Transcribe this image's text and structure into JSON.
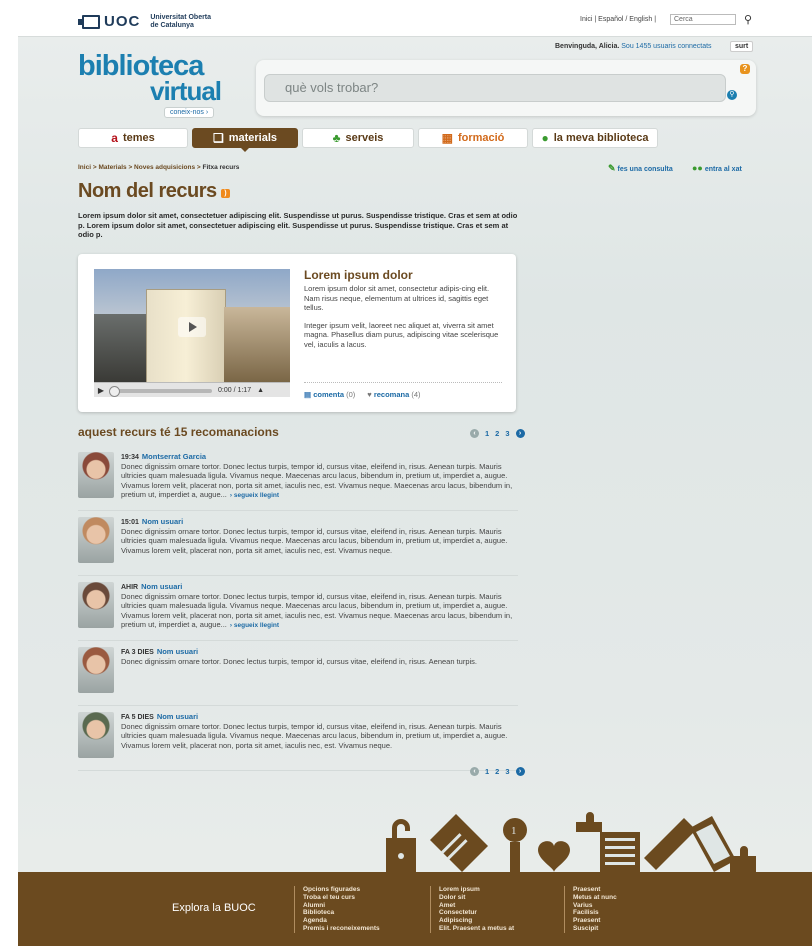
{
  "header": {
    "brand_short": "UOC",
    "brand_line1": "Universitat Oberta",
    "brand_line2": "de Catalunya",
    "toplinks": "Inici | Español / English |",
    "search_placeholder": "Cerca"
  },
  "user": {
    "welcome": "Benvinguda, Alicia.",
    "connected": "Sou 1455 usuaris connectats",
    "logout": "surt"
  },
  "logo": {
    "line1": "biblioteca",
    "line2": "virtual",
    "coneix": "coneix-nos"
  },
  "search": {
    "placeholder": "què vols trobar?"
  },
  "tabs": [
    {
      "label": "temes",
      "icon": "az-icon"
    },
    {
      "label": "materials",
      "icon": "book-icon",
      "active": true
    },
    {
      "label": "serveis",
      "icon": "services-icon"
    },
    {
      "label": "formació",
      "icon": "training-icon"
    },
    {
      "label": "la meva biblioteca",
      "icon": "person-icon"
    }
  ],
  "breadcrumb": {
    "items": [
      "Inici",
      "Materials",
      "Noves adquisicions"
    ],
    "sep": ">",
    "current": "Fitxa recurs"
  },
  "actions": {
    "consult": "fes una consulta",
    "chat": "entra al xat"
  },
  "page": {
    "title": "Nom del recurs",
    "intro": "Lorem ipsum dolor sit amet, consectetuer adipiscing elit. Suspendisse ut purus. Suspendisse tristique. Cras et sem at odio p. Lorem ipsum dolor sit amet, consectetuer adipiscing elit. Suspendisse ut purus. Suspendisse tristique. Cras et sem at odio p."
  },
  "card": {
    "title": "Lorem ipsum dolor",
    "para1": "Lorem ipsum dolor sit amet, consectetur adipis-cing elit. Nam risus neque, elementum at ultrices id, sagittis eget tellus.",
    "para2": "Integer ipsum velit, laoreet nec aliquet at, viverra sit amet magna. Phasellus diam purus, adipiscing vitae scelerisque vel, iaculis a lacus.",
    "time": "0:00 / 1:17",
    "progress": 0,
    "comment_label": "comenta",
    "comment_count": "(0)",
    "recommend_label": "recomana",
    "recommend_count": "(4)"
  },
  "recs": {
    "title": "aquest recurs té 15 recomanacions",
    "pages": [
      "1",
      "2",
      "3"
    ],
    "more": "segueix llegint",
    "items": [
      {
        "time": "19:34",
        "name": "Montserrat Garcia",
        "text": "Donec dignissim ornare tortor. Donec lectus turpis, tempor id, cursus vitae, eleifend in, risus. Aenean turpis. Mauris ultricies quam malesuada ligula. Vivamus neque. Maecenas arcu lacus, bibendum in, pretium ut, imperdiet a, augue. Vivamus lorem velit, placerat non, porta sit amet, iaculis nec, est. Vivamus neque. Maecenas arcu lacus, bibendum in, pretium ut, imperdiet a, augue...",
        "has_more": true,
        "avatar": "#8a4a3a"
      },
      {
        "time": "15:01",
        "name": "Nom usuari",
        "text": "Donec dignissim ornare tortor. Donec lectus turpis, tempor id, cursus vitae, eleifend in, risus. Aenean turpis. Mauris ultricies quam malesuada ligula. Vivamus neque. Maecenas arcu lacus, bibendum in, pretium ut, imperdiet a, augue. Vivamus lorem velit, placerat non, porta sit amet, iaculis nec, est. Vivamus neque.",
        "has_more": false,
        "avatar": "#c08a60"
      },
      {
        "time": "AHIR",
        "name": "Nom usuari",
        "text": "Donec dignissim ornare tortor. Donec lectus turpis, tempor id, cursus vitae, eleifend in, risus. Aenean turpis. Mauris ultricies quam malesuada ligula. Vivamus neque. Maecenas arcu lacus, bibendum in, pretium ut, imperdiet a, augue. Vivamus lorem velit, placerat non, porta sit amet, iaculis nec, est. Vivamus neque. Maecenas arcu lacus, bibendum in, pretium ut, imperdiet a, augue...",
        "has_more": true,
        "avatar": "#6a4a3a"
      },
      {
        "time": "FA 3 DIES",
        "name": "Nom usuari",
        "text": "Donec dignissim ornare tortor. Donec lectus turpis, tempor id, cursus vitae, eleifend in, risus. Aenean turpis.",
        "has_more": false,
        "avatar": "#9a5a40"
      },
      {
        "time": "FA 5 DIES",
        "name": "Nom usuari",
        "text": "Donec dignissim ornare tortor. Donec lectus turpis, tempor id, cursus vitae, eleifend in, risus. Aenean turpis. Mauris ultricies quam malesuada ligula. Vivamus neque. Maecenas arcu lacus, bibendum in, pretium ut, imperdiet a, augue. Vivamus lorem velit, placerat non, porta sit amet, iaculis nec, est. Vivamus neque.",
        "has_more": false,
        "avatar": "#5a6a50"
      }
    ]
  },
  "footer": {
    "title": "Explora la BUOC",
    "columns": [
      [
        "Opcions figurades",
        "Troba el teu curs",
        "Alumni",
        "Biblioteca",
        "Agenda",
        "Premis i reconeixements"
      ],
      [
        "Lorem ipsum",
        "Dolor sit",
        "Amet",
        "Consectetur",
        "Adipiscing",
        "Elit. Praesent a metus at"
      ],
      [
        "Praesent",
        "Metus at nunc",
        "Varius",
        "Facilisis",
        "Praesent",
        "Suscipit"
      ]
    ]
  },
  "colors": {
    "brown": "#6b4a21",
    "blue": "#1c7fb0",
    "link": "#1c6aa5",
    "footer": "#6b4a1f"
  }
}
